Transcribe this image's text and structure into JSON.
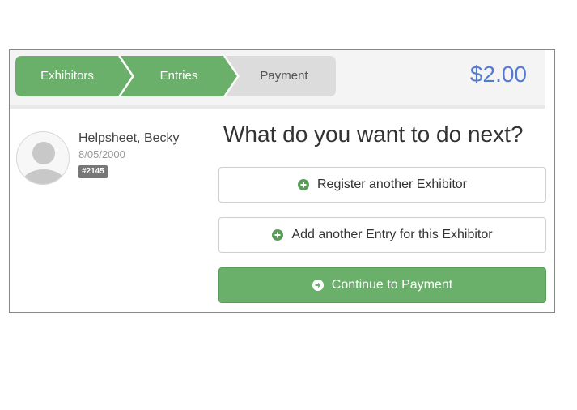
{
  "steps": [
    {
      "label": "Exhibitors",
      "state": "complete"
    },
    {
      "label": "Entries",
      "state": "complete"
    },
    {
      "label": "Payment",
      "state": "current"
    }
  ],
  "cart": {
    "total": "$2.00"
  },
  "exhibitor": {
    "name": "Helpsheet, Becky",
    "dob": "8/05/2000",
    "number": "#2145"
  },
  "next": {
    "heading": "What do you want to do next?",
    "register_label": "Register another Exhibitor",
    "add_entry_label": "Add another Entry for this Exhibitor",
    "continue_label": "Continue to Payment"
  },
  "icons": {
    "register": "plus-circle-icon",
    "add_entry": "plus-circle-icon",
    "continue": "arrow-circle-right-icon"
  },
  "colors": {
    "step_complete": "#6bb06a",
    "step_pending": "#dcdcdc",
    "total": "#5479d0",
    "primary_button": "#6bb06a",
    "frame_border": "#5b8fd1"
  }
}
